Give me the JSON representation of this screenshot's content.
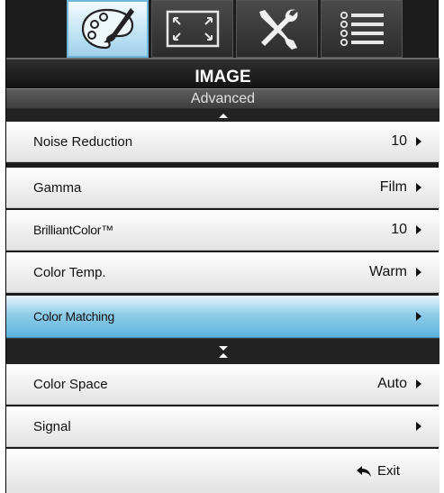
{
  "tabs": [
    {
      "name": "image-tab",
      "icon": "palette-icon",
      "active": true
    },
    {
      "name": "display-tab",
      "icon": "resize-icon",
      "active": false
    },
    {
      "name": "setup-tab",
      "icon": "tools-icon",
      "active": false
    },
    {
      "name": "options-tab",
      "icon": "list-icon",
      "active": false
    }
  ],
  "header": {
    "title": "IMAGE",
    "subtitle": "Advanced"
  },
  "rows": {
    "noise_reduction": {
      "label": "Noise Reduction",
      "value": "10"
    },
    "gamma": {
      "label": "Gamma",
      "value": "Film"
    },
    "brilliant_color": {
      "label": "BrilliantColor™",
      "value": "10"
    },
    "color_temp": {
      "label": "Color Temp.",
      "value": "Warm"
    },
    "color_matching": {
      "label": "Color Matching",
      "value": ""
    },
    "color_space": {
      "label": "Color Space",
      "value": "Auto"
    },
    "signal": {
      "label": "Signal",
      "value": ""
    }
  },
  "footer": {
    "exit_label": "Exit"
  },
  "colors": {
    "selected_row": "#5db3dc",
    "active_tab": "#bfe3f4",
    "background": "#1c1c1c"
  }
}
